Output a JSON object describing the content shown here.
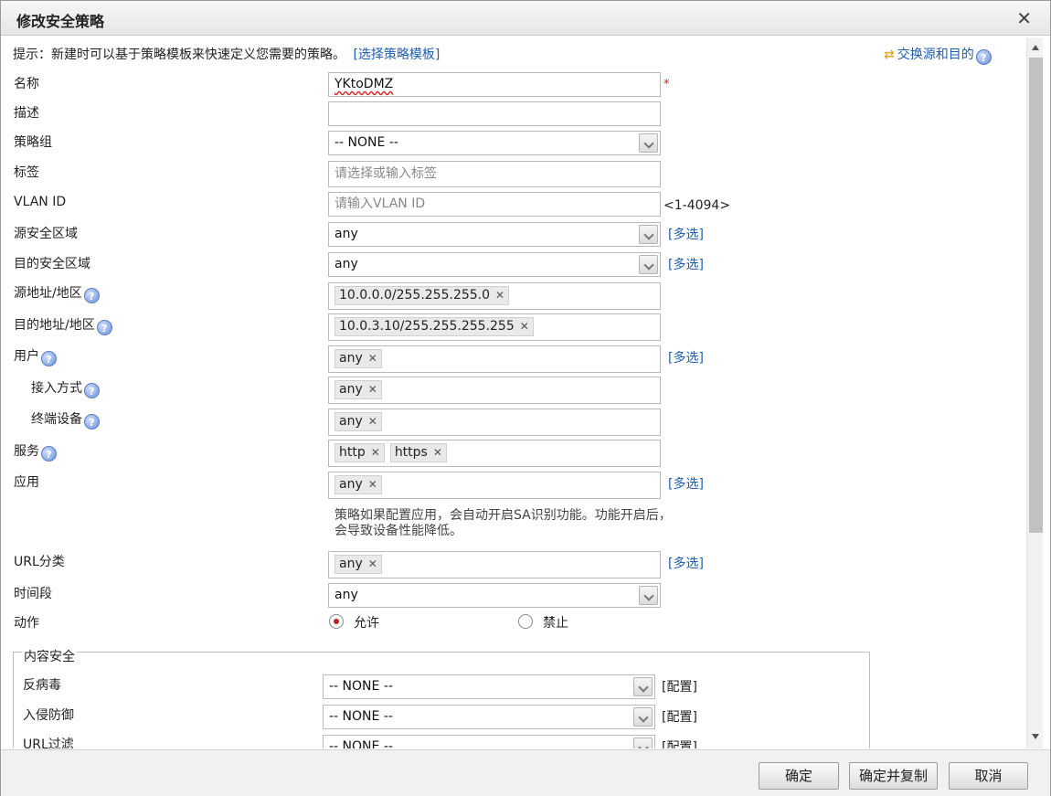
{
  "dialog": {
    "title": "修改安全策略"
  },
  "tip": {
    "text": "提示：新建时可以基于策略模板来快速定义您需要的策略。",
    "link": "[选择策略模板]"
  },
  "swap": {
    "label": "交换源和目的"
  },
  "fields": {
    "name": {
      "label": "名称",
      "value": "YKtoDMZ",
      "required_mark": "*"
    },
    "desc": {
      "label": "描述",
      "value": ""
    },
    "group": {
      "label": "策略组",
      "value": "-- NONE --"
    },
    "tag": {
      "label": "标签",
      "placeholder": "请选择或输入标签"
    },
    "vlan": {
      "label": "VLAN ID",
      "placeholder": "请输入VLAN ID",
      "range": "<1-4094>"
    },
    "src_zone": {
      "label": "源安全区域",
      "value": "any",
      "multi": "[多选]"
    },
    "dst_zone": {
      "label": "目的安全区域",
      "value": "any",
      "multi": "[多选]"
    },
    "src_addr": {
      "label": "源地址/地区",
      "tags": [
        "10.0.0.0/255.255.255.0"
      ]
    },
    "dst_addr": {
      "label": "目的地址/地区",
      "tags": [
        "10.0.3.10/255.255.255.255"
      ]
    },
    "user": {
      "label": "用户",
      "tags": [
        "any"
      ],
      "multi": "[多选]"
    },
    "access": {
      "label": "接入方式",
      "tags": [
        "any"
      ]
    },
    "terminal": {
      "label": "终端设备",
      "tags": [
        "any"
      ]
    },
    "service": {
      "label": "服务",
      "tags": [
        "http",
        "https"
      ]
    },
    "app": {
      "label": "应用",
      "tags": [
        "any"
      ],
      "multi": "[多选]",
      "hint": "策略如果配置应用，会自动开启SA识别功能。功能开启后，会导致设备性能降低。"
    },
    "url": {
      "label": "URL分类",
      "tags": [
        "any"
      ],
      "multi": "[多选]"
    },
    "time": {
      "label": "时间段",
      "value": "any"
    },
    "action": {
      "label": "动作",
      "allow": "允许",
      "deny": "禁止",
      "selected": "allow"
    }
  },
  "content_security": {
    "legend": "内容安全",
    "rows": [
      {
        "label": "反病毒",
        "value": "-- NONE --",
        "config": "[配置]"
      },
      {
        "label": "入侵防御",
        "value": "-- NONE --",
        "config": "[配置]"
      },
      {
        "label": "URL过滤",
        "value": "-- NONE --",
        "config": "[配置]"
      }
    ]
  },
  "footer": {
    "ok": "确定",
    "ok_copy": "确定并复制",
    "cancel": "取消"
  },
  "icons": {
    "close": "close-icon",
    "help": "help-icon",
    "swap": "swap-icon",
    "dropdown": "chevron-down-icon",
    "tag_remove": "close-icon"
  }
}
